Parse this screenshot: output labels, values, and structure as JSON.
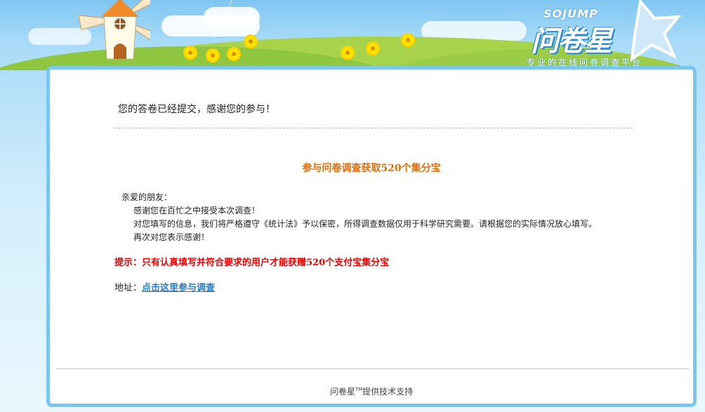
{
  "header": {
    "logo_en": "SOJUMP",
    "logo_cn": "问卷星",
    "logo_sub": "专业的在线问卷调查平台"
  },
  "main": {
    "success_msg": "您的答卷已经提交，感谢您的参与！",
    "title": "参与问卷调查获取520个集分宝",
    "greeting": "亲爱的朋友：",
    "lines": [
      "感谢您在百忙之中接受本次调查！",
      "对您填写的信息，我们将严格遵守《统计法》予以保密，所得调查数据仅用于科学研究需要。请根据您的实际情况放心填写。",
      "再次对您表示感谢！"
    ],
    "tip": "提示：只有认真填写并符合要求的用户才能获赠520个支付宝集分宝",
    "address_label": "地址：",
    "address_link": "点击这里参与调查"
  },
  "footer": {
    "brand": "问卷星",
    "tm": "TM",
    "text": "提供技术支持"
  },
  "colors": {
    "title": "#e36c09",
    "tip": "#ee0000",
    "link": "#2a7ac2",
    "panel_border": "#79c7f0"
  }
}
